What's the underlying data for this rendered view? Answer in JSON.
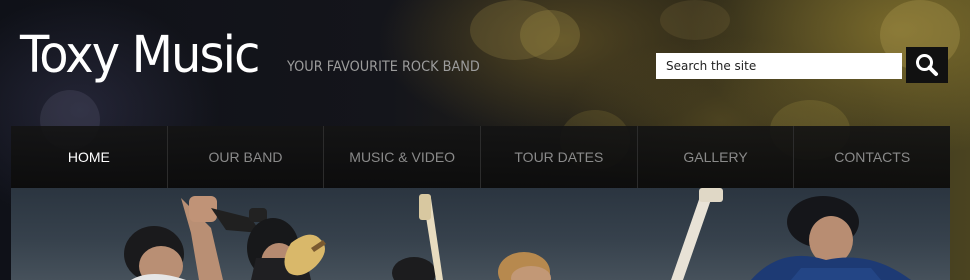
{
  "header": {
    "logo_text": "Toxy Music",
    "slogan": "YOUR FAVOURITE ROCK BAND"
  },
  "search": {
    "value": "Search the site",
    "button_icon": "magnifier-icon"
  },
  "nav": {
    "items": [
      {
        "label": "HOME",
        "active": true
      },
      {
        "label": "OUR BAND",
        "active": false
      },
      {
        "label": "MUSIC & VIDEO",
        "active": false
      },
      {
        "label": "TOUR DATES",
        "active": false
      },
      {
        "label": "GALLERY",
        "active": false
      },
      {
        "label": "CONTACTS",
        "active": false
      }
    ]
  },
  "colors": {
    "nav_active": "#ffffff",
    "nav_inactive": "#8a8a8a",
    "slogan": "#9c9c9c"
  }
}
